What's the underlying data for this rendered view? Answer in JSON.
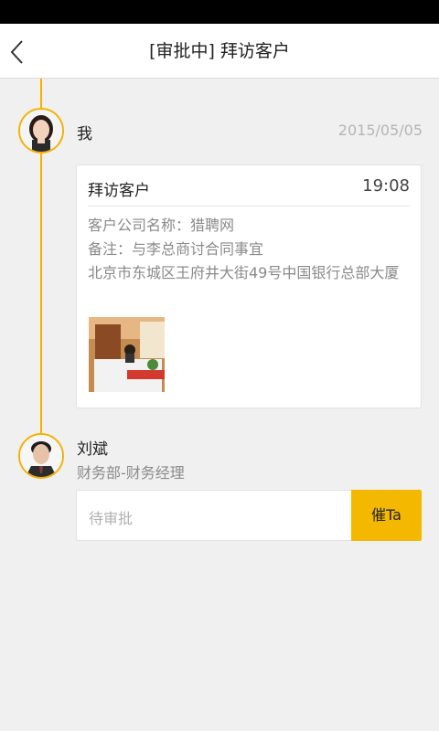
{
  "header": {
    "title": "[审批中] 拜访客户"
  },
  "timeline": [
    {
      "name": "我",
      "date": "2015/05/05",
      "card": {
        "title": "拜访客户",
        "time": "19:08",
        "lines": [
          "客户公司名称：猎聘网",
          "备注：与李总商讨合同事宜",
          "北京市东城区王府井大街49号中国银行总部大厦"
        ]
      }
    },
    {
      "name": "刘斌",
      "department": "财务部-财务经理",
      "status": "待审批",
      "urge_label": "催Ta"
    }
  ],
  "colors": {
    "accent": "#f5b800",
    "timeline": "#f5b100",
    "background": "#f0f0f0"
  },
  "icons": {
    "back": "chevron-left-icon"
  }
}
